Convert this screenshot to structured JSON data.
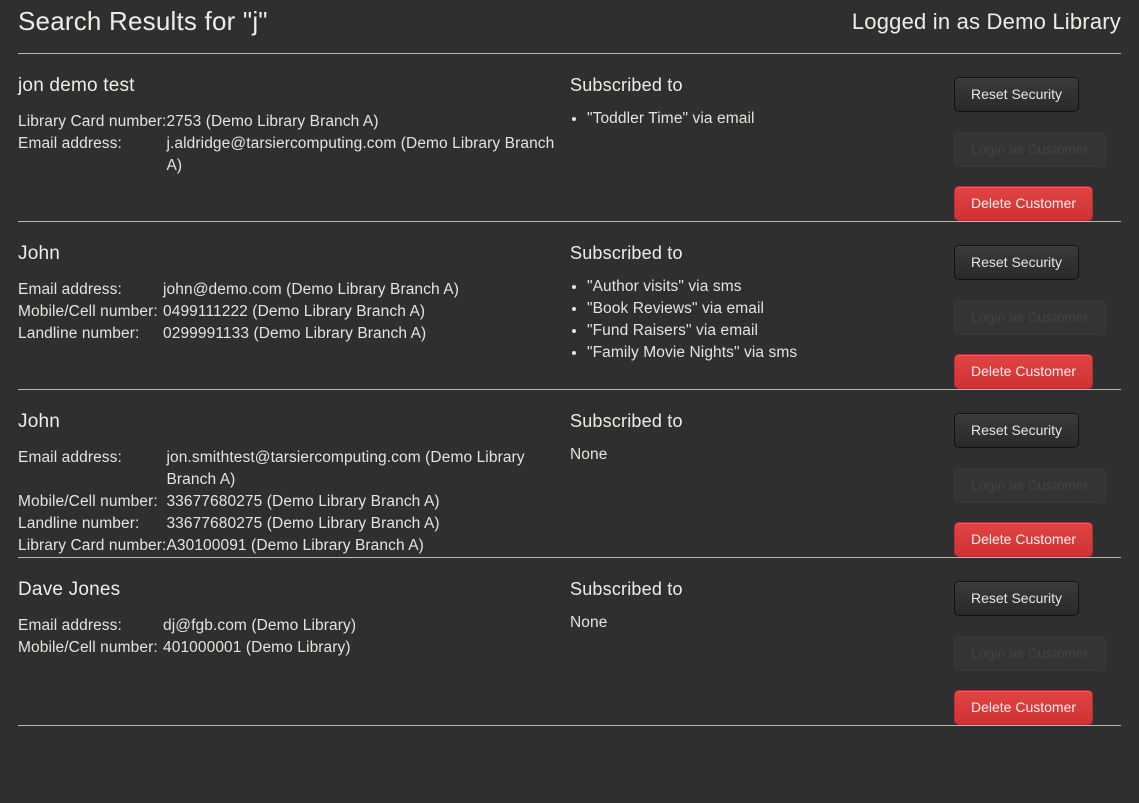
{
  "header": {
    "title": "Search Results for \"j\"",
    "login_status": "Logged in as Demo Library"
  },
  "actions": {
    "reset_security": "Reset Security",
    "login_as_customer": "Login as Customer",
    "delete_customer": "Delete Customer"
  },
  "labels": {
    "subscribed_heading": "Subscribed to",
    "none": "None"
  },
  "colors": {
    "background": "#2f2f2f",
    "text": "#e8e6e3",
    "divider": "#b9b7b4",
    "delete_button": "#d93b3b",
    "disabled_text": "#434343"
  },
  "results": [
    {
      "name": "jon demo test",
      "details": [
        {
          "label": "Library Card number:",
          "value": "2753 (Demo Library Branch A)"
        },
        {
          "label": "Email address:",
          "value": "j.aldridge@tarsiercomputing.com (Demo Library Branch A)"
        }
      ],
      "subscriptions": [
        "\"Toddler Time\" via email"
      ]
    },
    {
      "name": "John",
      "details": [
        {
          "label": "Email address:",
          "value": "john@demo.com (Demo Library Branch A)"
        },
        {
          "label": "Mobile/Cell number:",
          "value": "0499111222 (Demo Library Branch A)"
        },
        {
          "label": "Landline number:",
          "value": "0299991133 (Demo Library Branch A)"
        }
      ],
      "subscriptions": [
        "\"Author visits\" via sms",
        "\"Book Reviews\" via email",
        "\"Fund Raisers\" via email",
        "\"Family Movie Nights\" via sms"
      ]
    },
    {
      "name": "John",
      "details": [
        {
          "label": "Email address:",
          "value": "jon.smithtest@tarsiercomputing.com (Demo Library Branch A)"
        },
        {
          "label": "Mobile/Cell number:",
          "value": "33677680275 (Demo Library Branch A)"
        },
        {
          "label": "Landline number:",
          "value": "33677680275 (Demo Library Branch A)"
        },
        {
          "label": "Library Card number:",
          "value": "A30100091 (Demo Library Branch A)"
        }
      ],
      "subscriptions": []
    },
    {
      "name": "Dave Jones",
      "details": [
        {
          "label": "Email address:",
          "value": "dj@fgb.com (Demo Library)"
        },
        {
          "label": "Mobile/Cell number:",
          "value": "401000001 (Demo Library)"
        }
      ],
      "subscriptions": []
    }
  ]
}
